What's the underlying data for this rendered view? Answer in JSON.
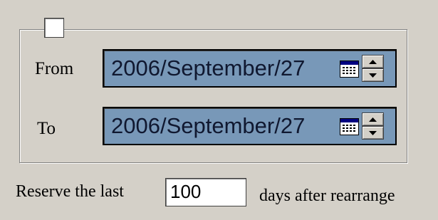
{
  "group": {
    "checked": false
  },
  "from": {
    "label": "From",
    "value": "2006/September/27"
  },
  "to": {
    "label": "To",
    "value": "2006/September/27"
  },
  "reserve": {
    "prefix": "Reserve the last",
    "days_value": "100",
    "suffix": "days after rearrange"
  },
  "colors": {
    "date_background": "#7898b8",
    "window_background": "#d4d0c8"
  },
  "icons": [
    "checkbox-icon",
    "calendar-icon",
    "spin-up-icon",
    "spin-down-icon"
  ]
}
